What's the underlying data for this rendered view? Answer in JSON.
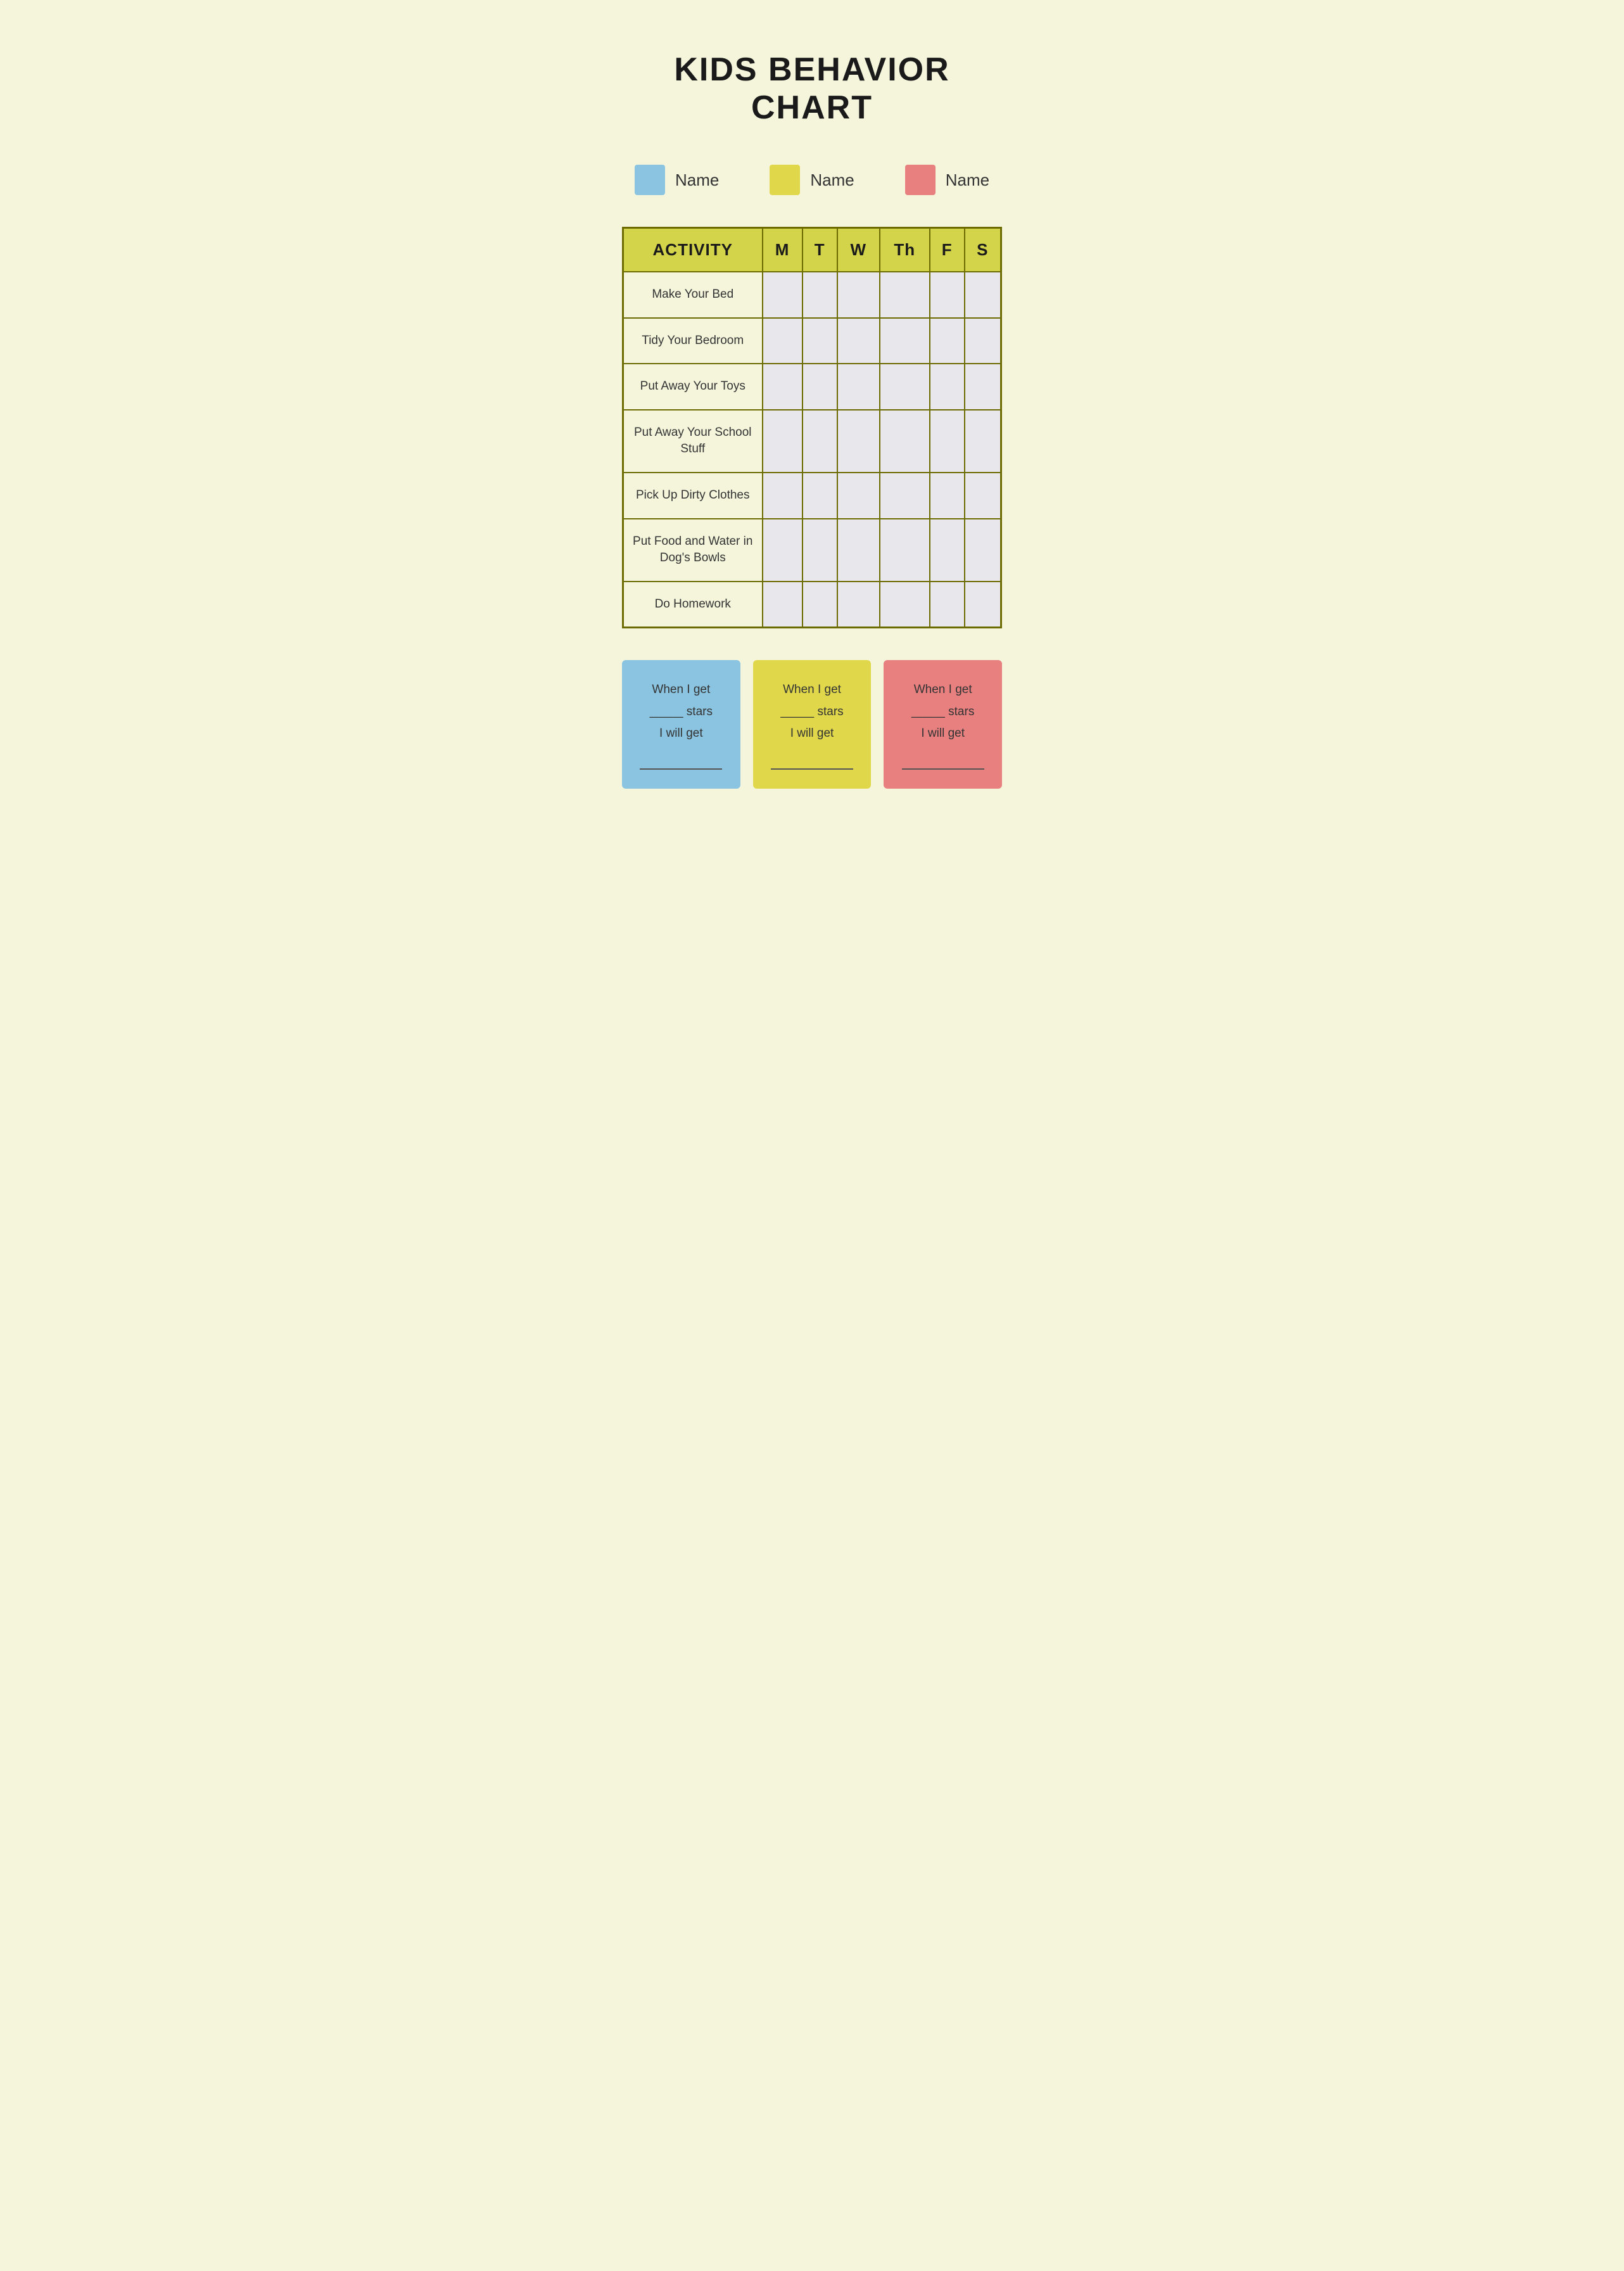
{
  "page": {
    "title": "KIDS BEHAVIOR CHART",
    "background_color": "#f5f5dc"
  },
  "legend": {
    "items": [
      {
        "color": "#8bc4e0",
        "label": "Name"
      },
      {
        "color": "#e0d84a",
        "label": "Name"
      },
      {
        "color": "#e88080",
        "label": "Name"
      }
    ]
  },
  "table": {
    "headers": {
      "activity": "ACTIVITY",
      "days": [
        "M",
        "T",
        "W",
        "Th",
        "F",
        "S"
      ]
    },
    "rows": [
      "Make Your Bed",
      "Tidy Your Bedroom",
      "Put Away Your Toys",
      "Put Away Your School Stuff",
      "Pick Up Dirty Clothes",
      "Put Food and Water in Dog's Bowls",
      "Do Homework"
    ]
  },
  "rewards": [
    {
      "color": "#8bc4e0",
      "line1": "When I get",
      "line2": "_____ stars",
      "line3": "I will get",
      "line4": "_______________"
    },
    {
      "color": "#e0d84a",
      "line1": "When I get",
      "line2": "_____ stars",
      "line3": "I will get",
      "line4": "_______________"
    },
    {
      "color": "#e88080",
      "line1": "When I get",
      "line2": "_____ stars",
      "line3": "I will get",
      "line4": "_______________"
    }
  ]
}
